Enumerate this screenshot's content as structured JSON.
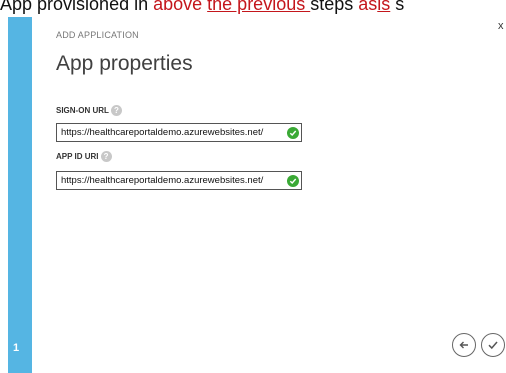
{
  "caption": {
    "part1": "App provisioned in ",
    "part2": "above ",
    "part3": "the previous ",
    "part4": "steps ",
    "part5": "as",
    "part6": "is",
    "part7": " s"
  },
  "wizard": {
    "header_label": "ADD APPLICATION",
    "title": "App properties",
    "step_number": "1",
    "close_glyph": "x"
  },
  "fields": {
    "sign_on": {
      "label": "SIGN-ON URL",
      "value": "https://healthcareportaldemo.azurewebsites.net/",
      "help_glyph": "?"
    },
    "app_id": {
      "label": "APP ID URI",
      "value": "https://healthcareportaldemo.azurewebsites.net/",
      "help_glyph": "?"
    }
  },
  "icons": {
    "validation": "check-circle-icon",
    "back": "arrow-left-icon",
    "complete": "checkmark-icon"
  },
  "colors": {
    "stripe": "#55b5e3",
    "valid": "#3aa935",
    "caption_red": "#c4161c"
  }
}
